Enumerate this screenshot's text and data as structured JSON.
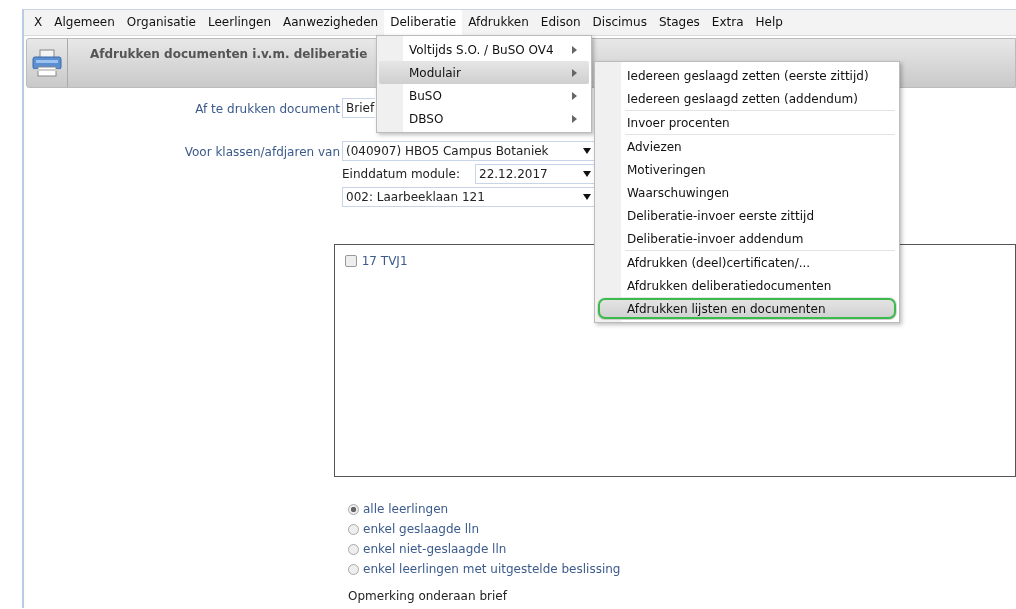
{
  "menu_bar": {
    "items": [
      {
        "label": "X",
        "selected": false
      },
      {
        "label": "Algemeen",
        "selected": false
      },
      {
        "label": "Organisatie",
        "selected": false
      },
      {
        "label": "Leerlingen",
        "selected": false
      },
      {
        "label": "Aanwezigheden",
        "selected": false
      },
      {
        "label": "Deliberatie",
        "selected": true
      },
      {
        "label": "Afdrukken",
        "selected": false
      },
      {
        "label": "Edison",
        "selected": false
      },
      {
        "label": "Discimus",
        "selected": false
      },
      {
        "label": "Stages",
        "selected": false
      },
      {
        "label": "Extra",
        "selected": false
      },
      {
        "label": "Help",
        "selected": false
      }
    ]
  },
  "header": {
    "title": "Afdrukken documenten i.v.m. deliberatie"
  },
  "form": {
    "document": {
      "label": "Af te drukken document",
      "value": "Brief"
    },
    "classes": {
      "label": "Voor klassen/afdjaren van",
      "value": "(040907) HBO5 Campus Botaniek"
    },
    "end_date": {
      "label": "Einddatum module:",
      "value": "22.12.2017"
    },
    "location": {
      "value": "002: Laarbeeklaan 121"
    },
    "class_list": [
      {
        "label": "17 TVJ1",
        "checked": false
      }
    ],
    "students": [
      {
        "label": "alle leerlingen",
        "selected": true
      },
      {
        "label": "enkel geslaagde lln",
        "selected": false
      },
      {
        "label": "enkel niet-geslaagde lln",
        "selected": false
      },
      {
        "label": "enkel leerlingen met uitgestelde beslissing",
        "selected": false
      }
    ],
    "remark_label": "Opmerking onderaan brief"
  },
  "dropdown": {
    "items": [
      {
        "label": "Voltijds S.O. / BuSO OV4",
        "has_submenu": true,
        "selected": false
      },
      {
        "label": "Modulair",
        "has_submenu": true,
        "selected": true
      },
      {
        "label": "BuSO",
        "has_submenu": true,
        "selected": false
      },
      {
        "label": "DBSO",
        "has_submenu": true,
        "selected": false
      }
    ]
  },
  "submenu": {
    "groups": [
      {
        "items": [
          {
            "label": "Iedereen geslaagd zetten (eerste zittijd)",
            "selected": false,
            "circled": false
          },
          {
            "label": "Iedereen geslaagd zetten (addendum)",
            "selected": false,
            "circled": false
          }
        ]
      },
      {
        "items": [
          {
            "label": "Invoer procenten",
            "selected": false,
            "circled": false
          }
        ]
      },
      {
        "items": [
          {
            "label": "Adviezen",
            "selected": false,
            "circled": false
          },
          {
            "label": "Motiveringen",
            "selected": false,
            "circled": false
          },
          {
            "label": "Waarschuwingen",
            "selected": false,
            "circled": false
          },
          {
            "label": "Deliberatie-invoer eerste zittijd",
            "selected": false,
            "circled": false
          },
          {
            "label": "Deliberatie-invoer addendum",
            "selected": false,
            "circled": false
          }
        ]
      },
      {
        "items": [
          {
            "label": "Afdrukken (deel)certificaten/...",
            "selected": false,
            "circled": false
          },
          {
            "label": "Afdrukken deliberatiedocumenten",
            "selected": false,
            "circled": false
          },
          {
            "label": "Afdrukken lijsten en documenten",
            "selected": true,
            "circled": true
          }
        ]
      }
    ]
  }
}
